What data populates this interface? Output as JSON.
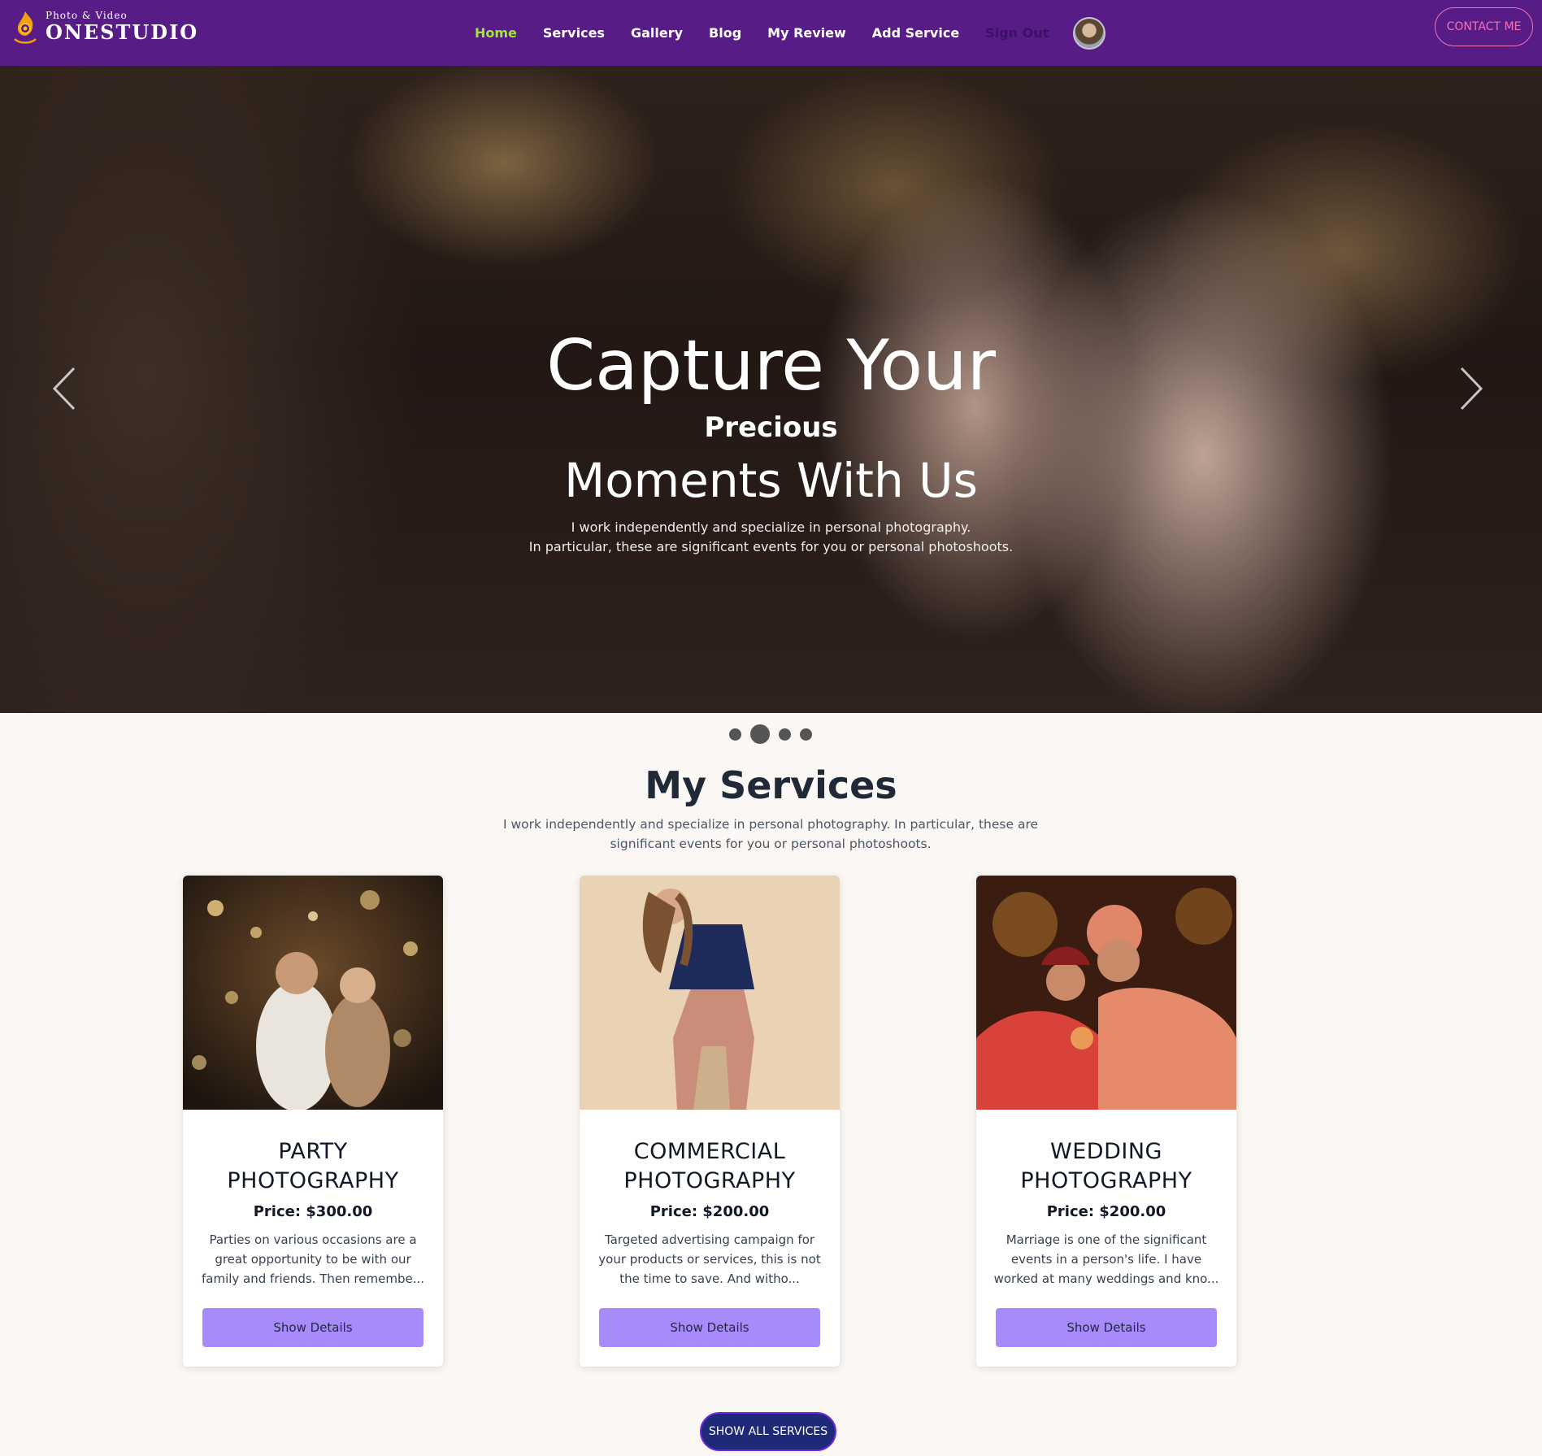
{
  "brand": {
    "tagline": "Photo & Video",
    "name": "ONESTUDIO"
  },
  "nav": {
    "items": [
      {
        "label": "Home"
      },
      {
        "label": "Services"
      },
      {
        "label": "Gallery"
      },
      {
        "label": "Blog"
      },
      {
        "label": "My Review"
      },
      {
        "label": "Add Service"
      }
    ],
    "signout": "Sign Out",
    "contact": "CONTACT ME"
  },
  "hero": {
    "title_line1": "Capture Your",
    "title_line2": "Precious",
    "title_line3": "Moments With Us",
    "desc_line1": "I work independently and specialize in personal photography.",
    "desc_line2": "In particular, these are significant events for you or personal photoshoots."
  },
  "services": {
    "title": "My Services",
    "description": "I work independently and specialize in personal photography. In particular, these are significant events for you or personal photoshoots.",
    "cards": [
      {
        "title": "PARTY PHOTOGRAPHY",
        "price": "Price: $300.00",
        "description": "Parties on various occasions are a great opportunity to be with our family and friends. Then remembe...",
        "button": "Show Details"
      },
      {
        "title": "COMMERCIAL PHOTOGRAPHY",
        "price": "Price: $200.00",
        "description": "Targeted advertising campaign for your products or services, this is not the time to save. And witho...",
        "button": "Show Details"
      },
      {
        "title": "WEDDING PHOTOGRAPHY",
        "price": "Price: $200.00",
        "description": "Marriage is one of the significant events in a person's life. I have worked at many weddings and kno...",
        "button": "Show Details"
      }
    ],
    "show_all": "SHOW ALL SERVICES"
  },
  "colors": {
    "navbar": "#581c87",
    "nav_active": "#a3e635",
    "contact_accent": "#f472b6",
    "card_button": "#a78bfa",
    "show_all_button": "#1e2a78",
    "page_background": "#fbf7f4"
  },
  "icons": {
    "logo": "camera-flame-logo-icon",
    "prev": "chevron-left-icon",
    "next": "chevron-right-icon"
  }
}
